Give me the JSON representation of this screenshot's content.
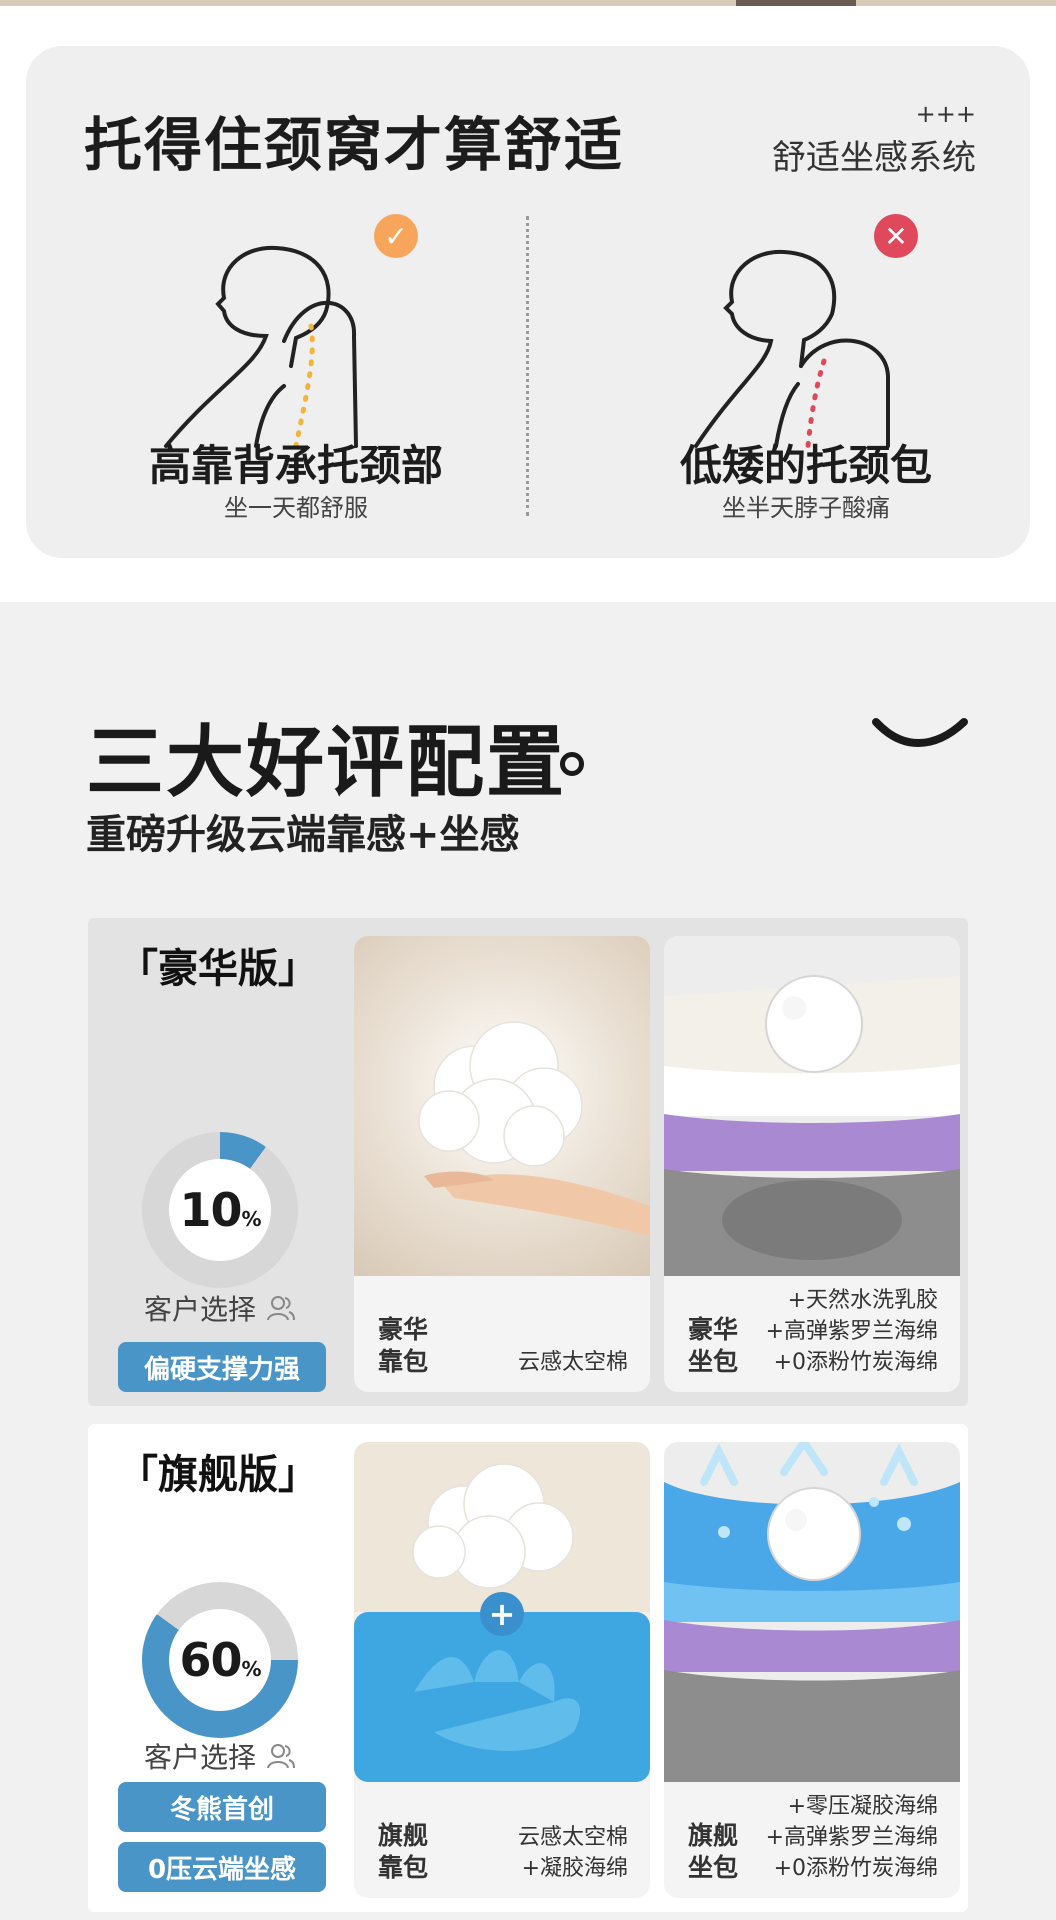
{
  "neck": {
    "title": "托得住颈窝才算舒适",
    "plus": "+++",
    "system": "舒适坐感系统",
    "good": {
      "title": "高靠背承托颈部",
      "sub": "坐一天都舒服",
      "badge": "✓"
    },
    "bad": {
      "title": "低矮的托颈包",
      "sub": "坐半天脖子酸痛",
      "badge": "✕"
    }
  },
  "section": {
    "title": "三大好评配置",
    "subtitle": "重磅升级云端靠感+坐感"
  },
  "editions": [
    {
      "title": "「豪华版」",
      "percent": 10,
      "percent_text": "10",
      "percent_unit": "%",
      "choose": "客户选择",
      "tags": [
        "偏硬支撑力强"
      ],
      "back": {
        "name": "豪华\n靠包",
        "features": [
          "云感太空棉"
        ]
      },
      "seat": {
        "name": "豪华\n坐包",
        "features": [
          "+天然水洗乳胶",
          "+高弹紫罗兰海绵",
          "+0添粉竹炭海绵"
        ]
      }
    },
    {
      "title": "「旗舰版」",
      "percent": 60,
      "percent_text": "60",
      "percent_unit": "%",
      "choose": "客户选择",
      "tags": [
        "冬熊首创",
        "0压云端坐感"
      ],
      "back": {
        "name": "旗舰\n靠包",
        "features": [
          "云感太空棉",
          "+凝胶海绵"
        ],
        "plus": "+"
      },
      "seat": {
        "name": "旗舰\n坐包",
        "features": [
          "+零压凝胶海绵",
          "+高弹紫罗兰海绵",
          "+0添粉竹炭海绵"
        ]
      }
    }
  ],
  "colors": {
    "accent": "#4a95c7",
    "good": "#f7a55a",
    "bad": "#e0485c",
    "donut_track": "#d7d7d7"
  }
}
